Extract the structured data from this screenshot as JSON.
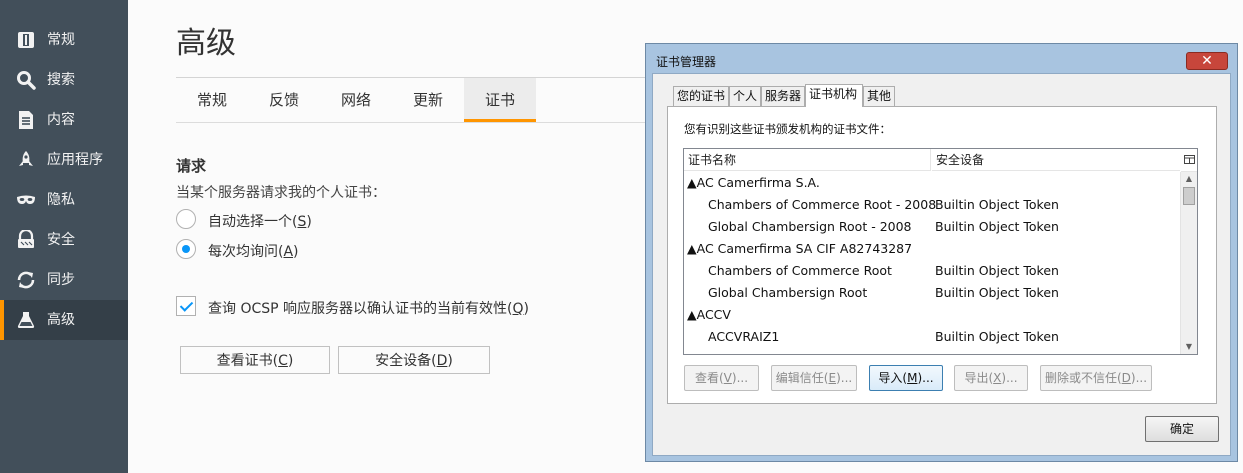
{
  "sidebar": {
    "items": [
      {
        "label": "常规",
        "icon": "general-icon",
        "active": false
      },
      {
        "label": "搜索",
        "icon": "search-icon",
        "active": false
      },
      {
        "label": "内容",
        "icon": "content-icon",
        "active": false
      },
      {
        "label": "应用程序",
        "icon": "applications-icon",
        "active": false
      },
      {
        "label": "隐私",
        "icon": "privacy-mask-icon",
        "active": false
      },
      {
        "label": "安全",
        "icon": "security-icon",
        "active": false
      },
      {
        "label": "同步",
        "icon": "sync-icon",
        "active": false
      },
      {
        "label": "高级",
        "icon": "advanced-icon",
        "active": true
      }
    ],
    "accent_color": "#ff9500"
  },
  "main": {
    "title": "高级",
    "tabs": [
      {
        "label": "常规"
      },
      {
        "label": "反馈"
      },
      {
        "label": "网络"
      },
      {
        "label": "更新"
      },
      {
        "label": "证书",
        "active": true
      }
    ],
    "section_title": "请求",
    "section_desc": "当某个服务器请求我的个人证书：",
    "radio_auto": {
      "text": "自动选择一个(",
      "key": "S",
      "tail": ")",
      "checked": false
    },
    "radio_ask": {
      "text": "每次均询问(",
      "key": "A",
      "tail": ")",
      "checked": true
    },
    "ocsp": {
      "text": "查询 OCSP 响应服务器以确认证书的当前有效性(",
      "key": "Q",
      "tail": ")",
      "checked": true
    },
    "view_certs_button": {
      "text": "查看证书(",
      "key": "C",
      "tail": ")"
    },
    "security_devices_button": {
      "text": "安全设备(",
      "key": "D",
      "tail": ")"
    }
  },
  "dialog": {
    "title": "证书管理器",
    "tabs": [
      {
        "label": "您的证书"
      },
      {
        "label": "个人"
      },
      {
        "label": "服务器"
      },
      {
        "label": "证书机构",
        "active": true
      },
      {
        "label": "其他"
      }
    ],
    "description": "您有识别这些证书颁发机构的证书文件：",
    "columns": {
      "name": "证书名称",
      "device": "安全设备"
    },
    "rows": [
      {
        "name": "▲AC Camerfirma S.A.",
        "device": "",
        "group": true
      },
      {
        "name": "Chambers of Commerce Root - 2008",
        "device": "Builtin Object Token",
        "group": false
      },
      {
        "name": "Global Chambersign Root - 2008",
        "device": "Builtin Object Token",
        "group": false
      },
      {
        "name": "▲AC Camerfirma SA CIF A82743287",
        "device": "",
        "group": true
      },
      {
        "name": "Chambers of Commerce Root",
        "device": "Builtin Object Token",
        "group": false
      },
      {
        "name": "Global Chambersign Root",
        "device": "Builtin Object Token",
        "group": false
      },
      {
        "name": "▲ACCV",
        "device": "",
        "group": true
      },
      {
        "name": "ACCVRAIZ1",
        "device": "Builtin Object Token",
        "group": false
      }
    ],
    "buttons": {
      "view": {
        "text": "查看(",
        "key": "V",
        "tail": ")..."
      },
      "edit_trust": {
        "text": "编辑信任(",
        "key": "E",
        "tail": ")..."
      },
      "import": {
        "text": "导入(",
        "key": "M",
        "tail": ")..."
      },
      "export": {
        "text": "导出(",
        "key": "X",
        "tail": ")..."
      },
      "delete": {
        "text": "删除或不信任(",
        "key": "D",
        "tail": ")..."
      }
    },
    "ok": "确定"
  }
}
